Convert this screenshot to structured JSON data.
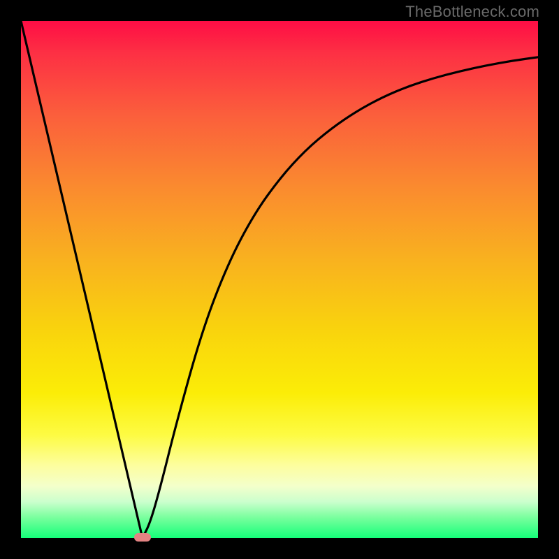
{
  "watermark": {
    "text": "TheBottleneck.com"
  },
  "colors": {
    "frame_bg": "#000000",
    "gradient_top": "#fe0d45",
    "gradient_bottom": "#14ff79",
    "curve_stroke": "#000000",
    "marker_fill": "#e38383"
  },
  "chart_data": {
    "type": "line",
    "title": "",
    "xlabel": "",
    "ylabel": "",
    "xlim": [
      0,
      100
    ],
    "ylim": [
      0,
      100
    ],
    "grid": false,
    "legend": false,
    "series": [
      {
        "name": "curve",
        "x": [
          0,
          5,
          10,
          15,
          20,
          23.5,
          25,
          27,
          30,
          35,
          40,
          45,
          50,
          55,
          60,
          65,
          70,
          75,
          80,
          85,
          90,
          95,
          100
        ],
        "y": [
          100,
          78.7,
          57.4,
          36.2,
          14.9,
          0,
          3,
          10,
          22,
          40,
          53,
          62.5,
          69.5,
          75,
          79.2,
          82.6,
          85.3,
          87.4,
          89,
          90.3,
          91.4,
          92.3,
          93
        ]
      }
    ],
    "marker": {
      "x": 23.5,
      "y": 0,
      "w": 3.2,
      "h": 1.6
    },
    "left_segment": {
      "x0": 0,
      "y0": 100,
      "x1": 23.5,
      "y1": 0
    }
  }
}
